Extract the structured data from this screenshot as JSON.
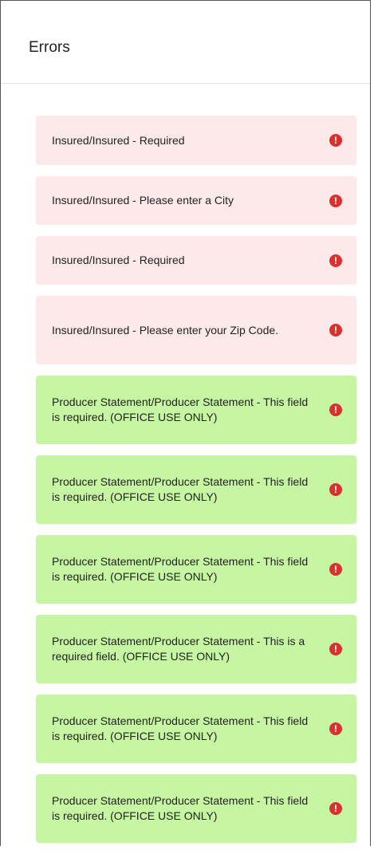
{
  "header": {
    "title": "Errors"
  },
  "icon": {
    "name": "exclamation-circle-icon",
    "color": "#d9312e",
    "glyph": "!"
  },
  "items": [
    {
      "type": "error",
      "text": "Insured/Insured - Required"
    },
    {
      "type": "error",
      "text": "Insured/Insured - Please enter a City"
    },
    {
      "type": "error",
      "text": "Insured/Insured - Required"
    },
    {
      "type": "error",
      "text": "Insured/Insured - Please enter your Zip Code."
    },
    {
      "type": "warning",
      "text": "Producer Statement/Producer Statement - This field is required. (OFFICE USE ONLY)"
    },
    {
      "type": "warning",
      "text": "Producer Statement/Producer Statement - This field is required. (OFFICE USE ONLY)"
    },
    {
      "type": "warning",
      "text": "Producer Statement/Producer Statement - This field is required. (OFFICE USE ONLY)"
    },
    {
      "type": "warning",
      "text": "Producer Statement/Producer Statement - This is a required field. (OFFICE USE ONLY)"
    },
    {
      "type": "warning",
      "text": "Producer Statement/Producer Statement - This field is required. (OFFICE USE ONLY)"
    },
    {
      "type": "warning",
      "text": "Producer Statement/Producer Statement - This field is required. (OFFICE USE ONLY)"
    }
  ],
  "colors": {
    "error_bg": "#fde9e9",
    "warning_bg": "#c6f6a1",
    "icon_bg": "#d9312e"
  }
}
